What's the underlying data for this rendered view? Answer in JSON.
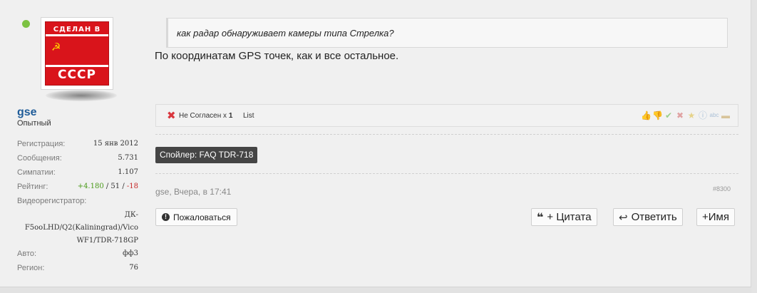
{
  "user": {
    "avatar_top_text": "СДЕЛАН В",
    "avatar_bottom_text": "СССР",
    "name": "gse",
    "title": "Опытный",
    "info": [
      {
        "label": "Регистрация:",
        "value": "15 янв 2012"
      },
      {
        "label": "Сообщения:",
        "value": "5.731"
      },
      {
        "label": "Симпатии:",
        "value": "1.107"
      }
    ],
    "rating_label": "Рейтинг:",
    "rating_pos": "+4.180",
    "rating_mid": " / 51 / ",
    "rating_neg": "-18",
    "dvr_label": "Видеорегистратор:",
    "dvr_lines": [
      "ДК-",
      "F5ooLHD/Q2(Kaliningrad)/Vico",
      "WF1/TDR-718GP"
    ],
    "auto_label": "Авто:",
    "auto_value": "фф3",
    "region_label": "Регион:",
    "region_value": "76"
  },
  "post": {
    "quote": "как радар обнаруживает камеры типа Стрелка?",
    "message": "По координатам GPS точек, как и все остальное.",
    "rating": {
      "label": "Не Согласен x",
      "count": "1",
      "list_label": "List"
    },
    "spoiler": "Спойлер: FAQ TDR-718",
    "meta": "gse, Вчера, в 17:41",
    "number": "#8300"
  },
  "buttons": {
    "report": "Пожаловаться",
    "quote": "+ Цитата",
    "reply": "Ответить",
    "name": "+Имя"
  },
  "colors": {
    "username": "#1f5c99",
    "online": "#7cc242",
    "rating_pos": "#4a9a1a",
    "rating_neg": "#c62828",
    "spoiler_bg": "#454545"
  }
}
